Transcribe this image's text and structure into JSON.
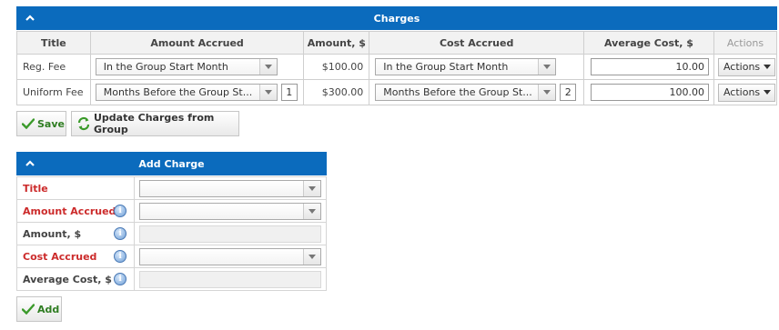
{
  "charges": {
    "header": "Charges",
    "columns": [
      "Title",
      "Amount Accrued",
      "Amount, $",
      "Cost Accrued",
      "Average Cost, $",
      "Actions"
    ],
    "rows": [
      {
        "title": "Reg. Fee",
        "amount_accrued": "In the Group Start Month",
        "amount_accrued_num": "",
        "amount": "$100.00",
        "cost_accrued": "In the Group Start Month",
        "cost_accrued_num": "",
        "average_cost": "10.00",
        "actions": "Actions"
      },
      {
        "title": "Uniform Fee",
        "amount_accrued": "Months Before the Group St...",
        "amount_accrued_num": "1",
        "amount": "$300.00",
        "cost_accrued": "Months Before the Group St...",
        "cost_accrued_num": "2",
        "average_cost": "100.00",
        "actions": "Actions"
      }
    ],
    "save_label": "Save",
    "update_label": "Update Charges from Group"
  },
  "add_charge": {
    "header": "Add Charge",
    "fields": {
      "title": "Title",
      "amount_accrued": "Amount Accrued",
      "amount": "Amount, $",
      "cost_accrued": "Cost Accrued",
      "average_cost": "Average Cost, $"
    },
    "info_glyph": "i",
    "add_label": "Add"
  },
  "colors": {
    "header_bg": "#0b6bbd",
    "required_label": "#cc2b2b",
    "check_green": "#3a9a2a"
  },
  "icons": [
    "chevron-up-icon",
    "chevron-down-icon",
    "caret-down-icon",
    "check-icon",
    "refresh-icon",
    "info-icon"
  ]
}
